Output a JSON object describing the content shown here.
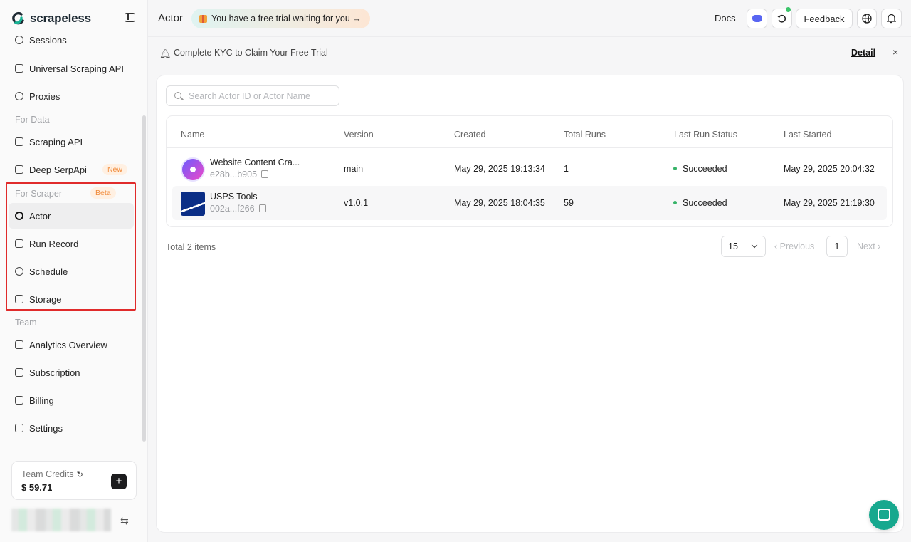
{
  "brand": {
    "name": "scrapeless"
  },
  "sidebar": {
    "items_top": [
      {
        "label": "Sessions",
        "icon": "sessions-icon"
      },
      {
        "label": "Universal Scraping API",
        "icon": "lock-icon"
      },
      {
        "label": "Proxies",
        "icon": "globe-icon"
      }
    ],
    "section_data": "For Data",
    "items_data": [
      {
        "label": "Scraping API",
        "icon": "api-icon"
      },
      {
        "label": "Deep SerpApi",
        "icon": "search-api-icon",
        "badge": "New"
      }
    ],
    "section_scraper": "For Scraper",
    "section_scraper_badge": "Beta",
    "items_scraper": [
      {
        "label": "Actor",
        "icon": "actor-icon",
        "active": true
      },
      {
        "label": "Run Record",
        "icon": "record-icon"
      },
      {
        "label": "Schedule",
        "icon": "clock-icon"
      },
      {
        "label": "Storage",
        "icon": "storage-icon"
      }
    ],
    "section_team": "Team",
    "items_team": [
      {
        "label": "Analytics Overview",
        "icon": "analytics-icon"
      },
      {
        "label": "Subscription",
        "icon": "subscription-icon"
      },
      {
        "label": "Billing",
        "icon": "billing-icon"
      },
      {
        "label": "Settings",
        "icon": "settings-icon"
      }
    ],
    "credits": {
      "label": "Team Credits",
      "value": "$ 59.71",
      "add": "+"
    },
    "switch_icon": "⇆"
  },
  "topbar": {
    "title": "Actor",
    "trial": "You have a free trial waiting for you →",
    "docs": "Docs",
    "feedback": "Feedback"
  },
  "kyc": {
    "text": "Complete KYC to Claim Your Free Trial",
    "detail": "Detail",
    "close": "×"
  },
  "search": {
    "placeholder": "Search Actor ID or Actor Name",
    "value": ""
  },
  "table": {
    "headers": [
      "Name",
      "Version",
      "Created",
      "Total Runs",
      "Last Run Status",
      "Last Started"
    ],
    "rows": [
      {
        "name": "Website Content Cra...",
        "id": "e28b...b905",
        "version": "main",
        "created": "May 29, 2025 19:13:34",
        "runs": "1",
        "status": "Succeeded",
        "last_started": "May 29, 2025 20:04:32"
      },
      {
        "name": "USPS Tools",
        "id": "002a...f266",
        "version": "v1.0.1",
        "created": "May 29, 2025 18:04:35",
        "runs": "59",
        "status": "Succeeded",
        "last_started": "May 29, 2025 21:19:30"
      }
    ]
  },
  "pagination": {
    "total": "Total 2 items",
    "page_size": "15",
    "previous": "‹ Previous",
    "current": "1",
    "next": "Next ›"
  },
  "colors": {
    "status_success": "#36b368",
    "highlight": "#e02b2b",
    "chat": "#17a88e"
  }
}
